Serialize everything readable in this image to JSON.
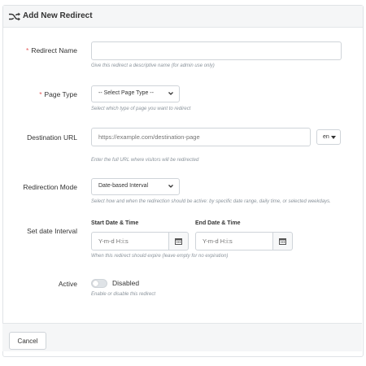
{
  "header": {
    "title": "Add New Redirect",
    "icon": "shuffle-icon"
  },
  "fields": {
    "redirect_name": {
      "required_mark": "*",
      "label": "Redirect Name",
      "value": "",
      "help": "Give this redirect a descriptive name (for admin use only)"
    },
    "page_type": {
      "required_mark": "*",
      "label": "Page Type",
      "selected": "-- Select Page Type --",
      "help": "Select which type of page you want to redirect"
    },
    "destination_url": {
      "label": "Destination URL",
      "placeholder": "https://example.com/destination-page",
      "language": "en",
      "help": "Enter the full URL where visitors will be redirected"
    },
    "redirection_mode": {
      "label": "Redirection Mode",
      "selected": "Date-based Interval",
      "help": "Select how and when the redirection should be active: by specific date range, daily time, or selected weekdays."
    },
    "date_interval": {
      "label": "Set date Interval",
      "start_label": "Start Date & Time",
      "start_placeholder": "Y-m-d H:i:s",
      "end_label": "End Date & Time",
      "end_placeholder": "Y-m-d H:i:s",
      "help": "When this redirect should expire (leave empty for no expiration)"
    },
    "active": {
      "label": "Active",
      "state": "Disabled",
      "enabled": false,
      "help": "Enable or disable this redirect"
    }
  },
  "footer": {
    "cancel_label": "Cancel"
  },
  "colors": {
    "required": "#e45a5a",
    "header_bg": "#f5f6f7",
    "border": "#cfd4d9"
  }
}
